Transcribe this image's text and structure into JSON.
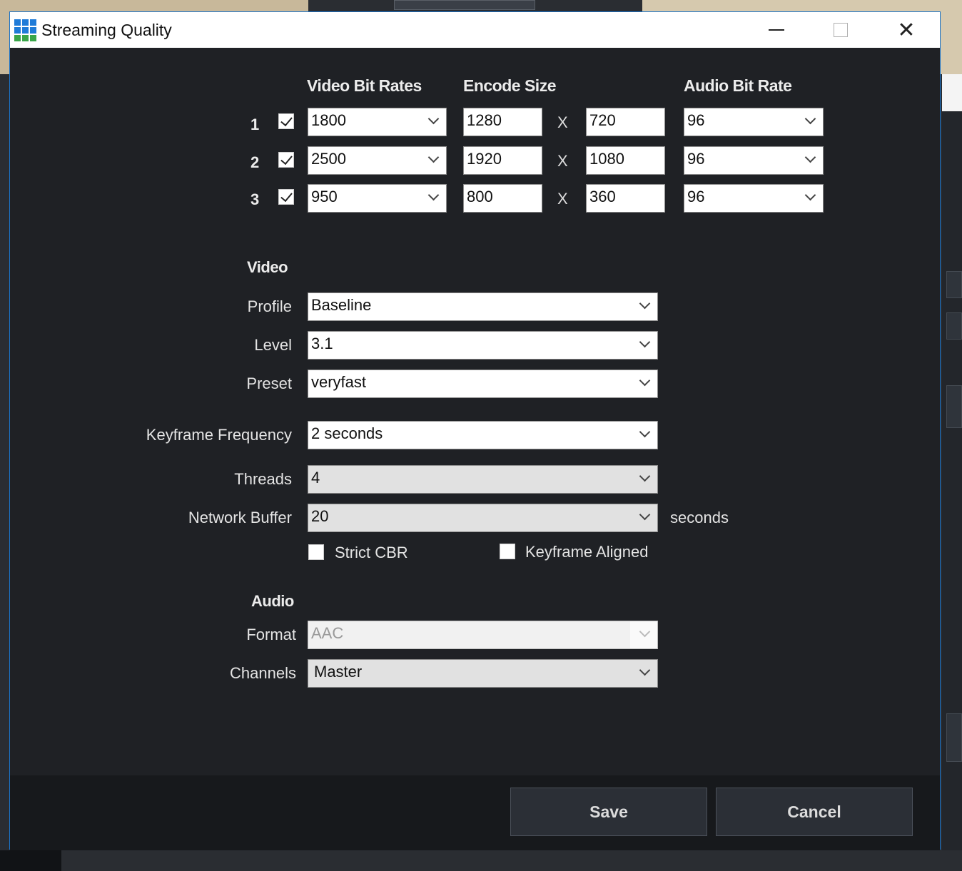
{
  "window": {
    "title": "Streaming Quality"
  },
  "headers": {
    "video_bit_rates": "Video Bit Rates",
    "encode_size": "Encode Size",
    "audio_bit_rate": "Audio Bit Rate"
  },
  "renditions": [
    {
      "num": "1",
      "enabled": true,
      "video_bitrate": "1800",
      "width": "1280",
      "x": "X",
      "height": "720",
      "audio_bitrate": "96"
    },
    {
      "num": "2",
      "enabled": true,
      "video_bitrate": "2500",
      "width": "1920",
      "x": "X",
      "height": "1080",
      "audio_bitrate": "96"
    },
    {
      "num": "3",
      "enabled": true,
      "video_bitrate": "950",
      "width": "800",
      "x": "X",
      "height": "360",
      "audio_bitrate": "96"
    }
  ],
  "video": {
    "heading": "Video",
    "profile_label": "Profile",
    "profile": "Baseline",
    "level_label": "Level",
    "level": "3.1",
    "preset_label": "Preset",
    "preset": "veryfast",
    "keyframe_label": "Keyframe Frequency",
    "keyframe": "2 seconds",
    "threads_label": "Threads",
    "threads": "4",
    "buffer_label": "Network Buffer",
    "buffer": "20",
    "buffer_suffix": "seconds",
    "strict_cbr_label": "Strict CBR",
    "strict_cbr": false,
    "keyframe_aligned_label": "Keyframe Aligned",
    "keyframe_aligned": false
  },
  "audio": {
    "heading": "Audio",
    "format_label": "Format",
    "format": "AAC",
    "channels_label": "Channels",
    "channels": "Master"
  },
  "buttons": {
    "save": "Save",
    "cancel": "Cancel"
  },
  "colors": {
    "window_bg": "#1f2125",
    "footer_bg": "#17191c",
    "accent_border": "#1a73c8"
  }
}
